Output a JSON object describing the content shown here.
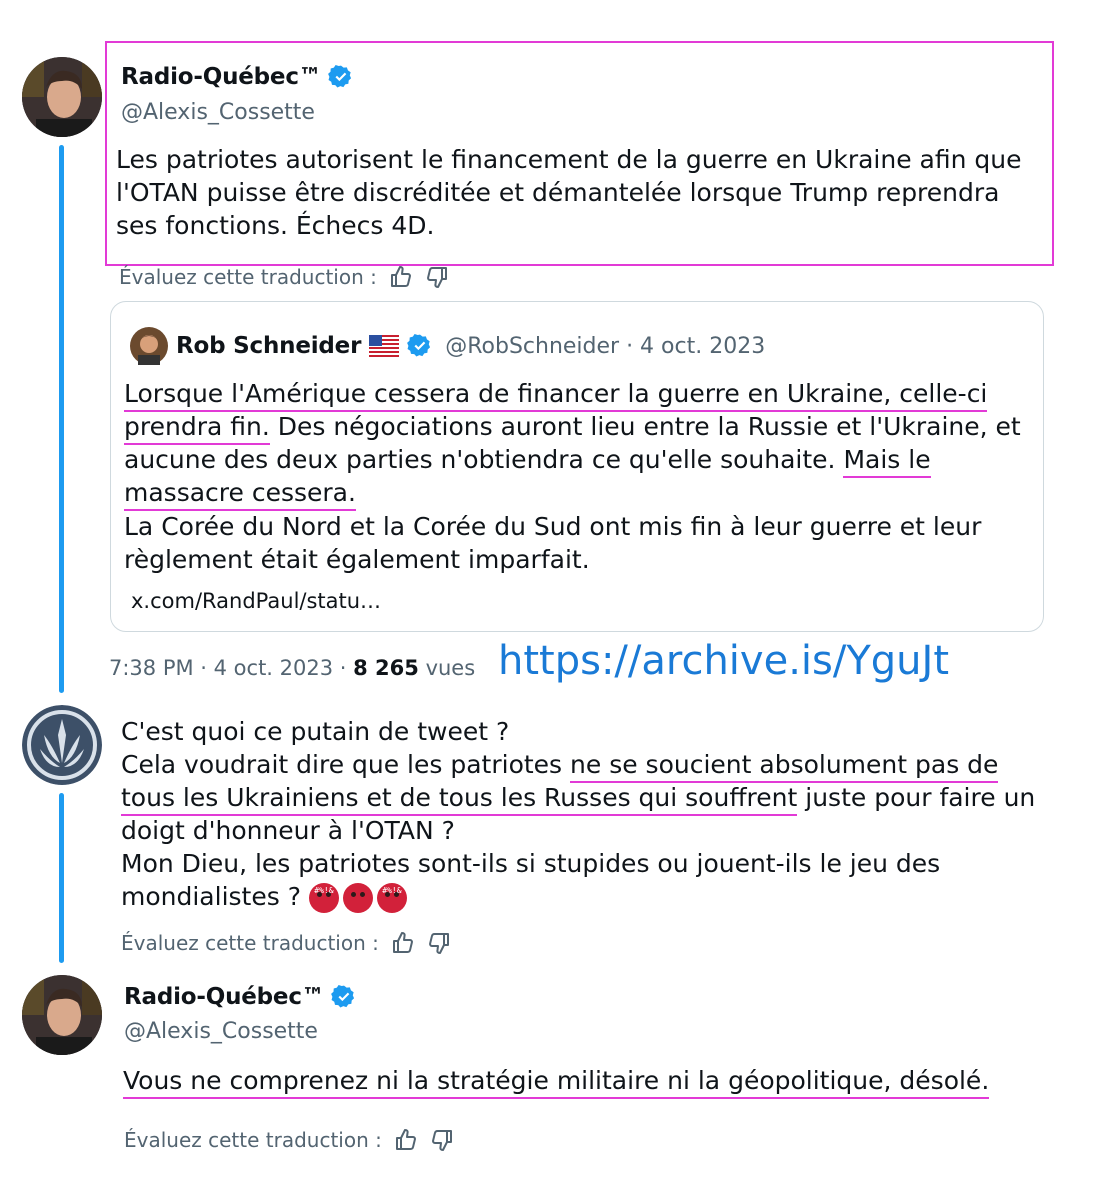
{
  "tweet1": {
    "name": "Radio-Québec™",
    "handle": "@Alexis_Cossette",
    "text": "Les patriotes autorisent le financement de la guerre en Ukraine afin que l'OTAN puisse être discréditée et démantelée lorsque Trump reprendra ses fonctions. Échecs 4D.",
    "rate_label": "Évaluez cette traduction :"
  },
  "quote": {
    "name": "Rob Schneider",
    "handle_date": "@RobSchneider · 4 oct. 2023",
    "part1": "Lorsque l'Amérique cessera de financer la guerre en Ukraine, celle-ci prendra fin.",
    "part2": " Des négociations auront lieu entre la Russie et l'Ukraine, et aucune des deux parties n'obtiendra ce qu'elle souhaite. ",
    "part3": "Mais le massacre cessera.",
    "line2": "La Corée du Nord et la Corée du Sud ont mis fin à leur guerre et leur règlement était également imparfait.",
    "link": "x.com/RandPaul/statu…"
  },
  "meta": {
    "time_date": "7:38 PM · 4 oct. 2023 · ",
    "views_count": "8 265",
    "views_label": " vues",
    "archive_link": "https://archive.is/YguJt"
  },
  "reply1": {
    "line1": "C'est quoi ce putain de tweet ?",
    "line2_a": "Cela voudrait dire que les patriotes ",
    "line2_b": "ne se soucient absolument pas de tous les Ukrainiens et de tous les Russes qui souffrent",
    "line2_c": " juste pour faire un doigt d'honneur à l'OTAN ?",
    "line3": "Mon Dieu, les patriotes sont-ils si stupides ou jouent-ils le jeu des mondialistes ?",
    "emojis": [
      "#%!&",
      "",
      "#%!&"
    ],
    "rate_label": "Évaluez cette traduction :"
  },
  "reply2": {
    "name": "Radio-Québec™",
    "handle": "@Alexis_Cossette",
    "text": "Vous ne comprenez ni la stratégie militaire ni la géopolitique, désolé.",
    "rate_label": "Évaluez cette traduction :"
  },
  "colors": {
    "accent": "#1d9bf0",
    "highlight": "#e23ad6",
    "link": "#1a7ad6"
  }
}
